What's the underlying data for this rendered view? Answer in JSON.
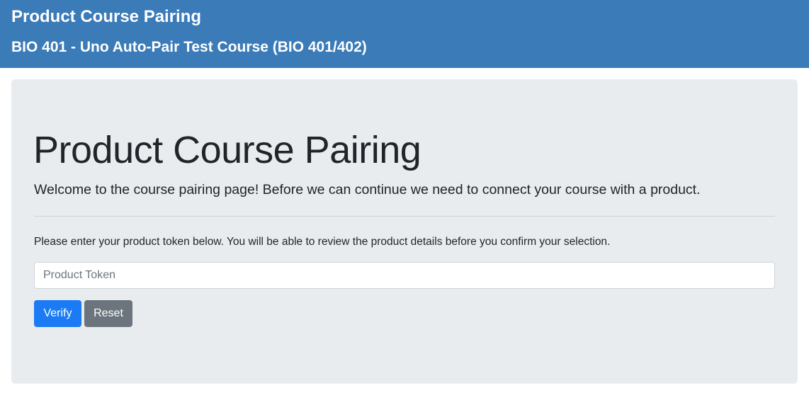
{
  "header": {
    "title": "Product Course Pairing",
    "subtitle": "BIO 401 - Uno Auto-Pair Test Course (BIO 401/402)"
  },
  "main": {
    "heading": "Product Course Pairing",
    "lead": "Welcome to the course pairing page! Before we can continue we need to connect your course with a product.",
    "instructions": "Please enter your product token below. You will be able to review the product details before you confirm your selection.",
    "token_input": {
      "value": "",
      "placeholder": "Product Token"
    },
    "buttons": {
      "verify_label": "Verify",
      "reset_label": "Reset"
    }
  },
  "colors": {
    "header_bg": "#3a7bb8",
    "panel_bg": "#e9ecef",
    "primary": "#1b7bf5",
    "secondary": "#6c757d"
  }
}
